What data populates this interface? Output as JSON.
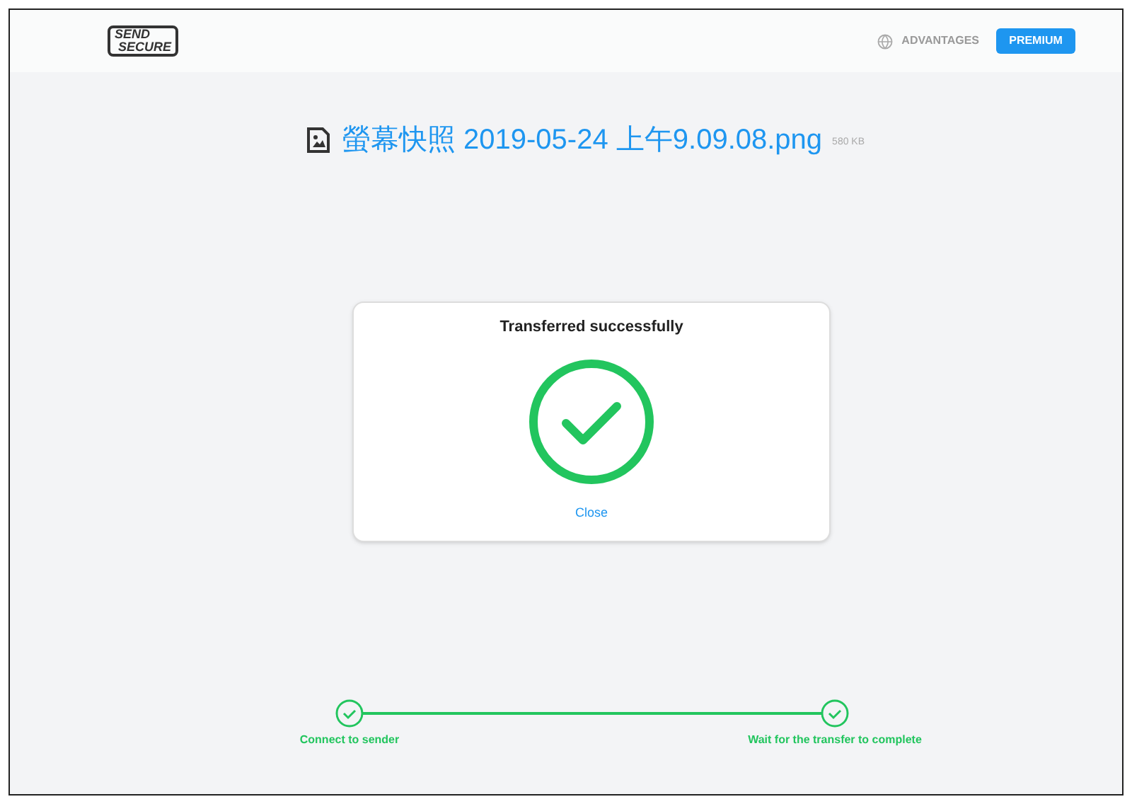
{
  "header": {
    "logo": [
      "SEND",
      "SECURE"
    ],
    "nav_link": "ADVANTAGES",
    "premium_button": "PREMIUM"
  },
  "file": {
    "name": "螢幕快照 2019-05-24 上午9.09.08.png",
    "size": "580 KB"
  },
  "dialog": {
    "title": "Transferred successfully",
    "succeeded": true,
    "close": "Close"
  },
  "steps": [
    {
      "label": "Connect to sender",
      "done": true
    },
    {
      "label": "Wait for the transfer to complete",
      "done": true
    }
  ]
}
